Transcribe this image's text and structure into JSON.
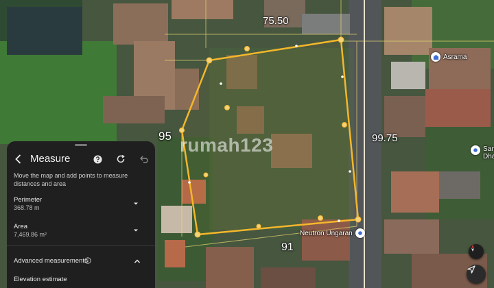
{
  "map": {
    "edge_labels": {
      "top": "75.50",
      "left": "95",
      "right": "99.75",
      "bottom": "91"
    },
    "places": [
      {
        "name": "Asrama",
        "icon": "building-icon"
      },
      {
        "name": "San",
        "line2": "Dha",
        "icon": "place-icon"
      },
      {
        "name": "Neutron Ungaran",
        "icon": "place-icon"
      }
    ],
    "watermark": "rumah123",
    "polygon_color": "#f5b72a"
  },
  "panel": {
    "title": "Measure",
    "description": "Move the map and add points to measure distances and area",
    "perimeter": {
      "label": "Perimeter",
      "value": "368.78 m"
    },
    "area": {
      "label": "Area",
      "value": "7,469.86 m²"
    },
    "advanced_label": "Advanced measurements",
    "elevation_label": "Elevation estimate"
  },
  "colors": {
    "panel_bg": "#1f1f1f",
    "accent": "#f5b72a"
  }
}
